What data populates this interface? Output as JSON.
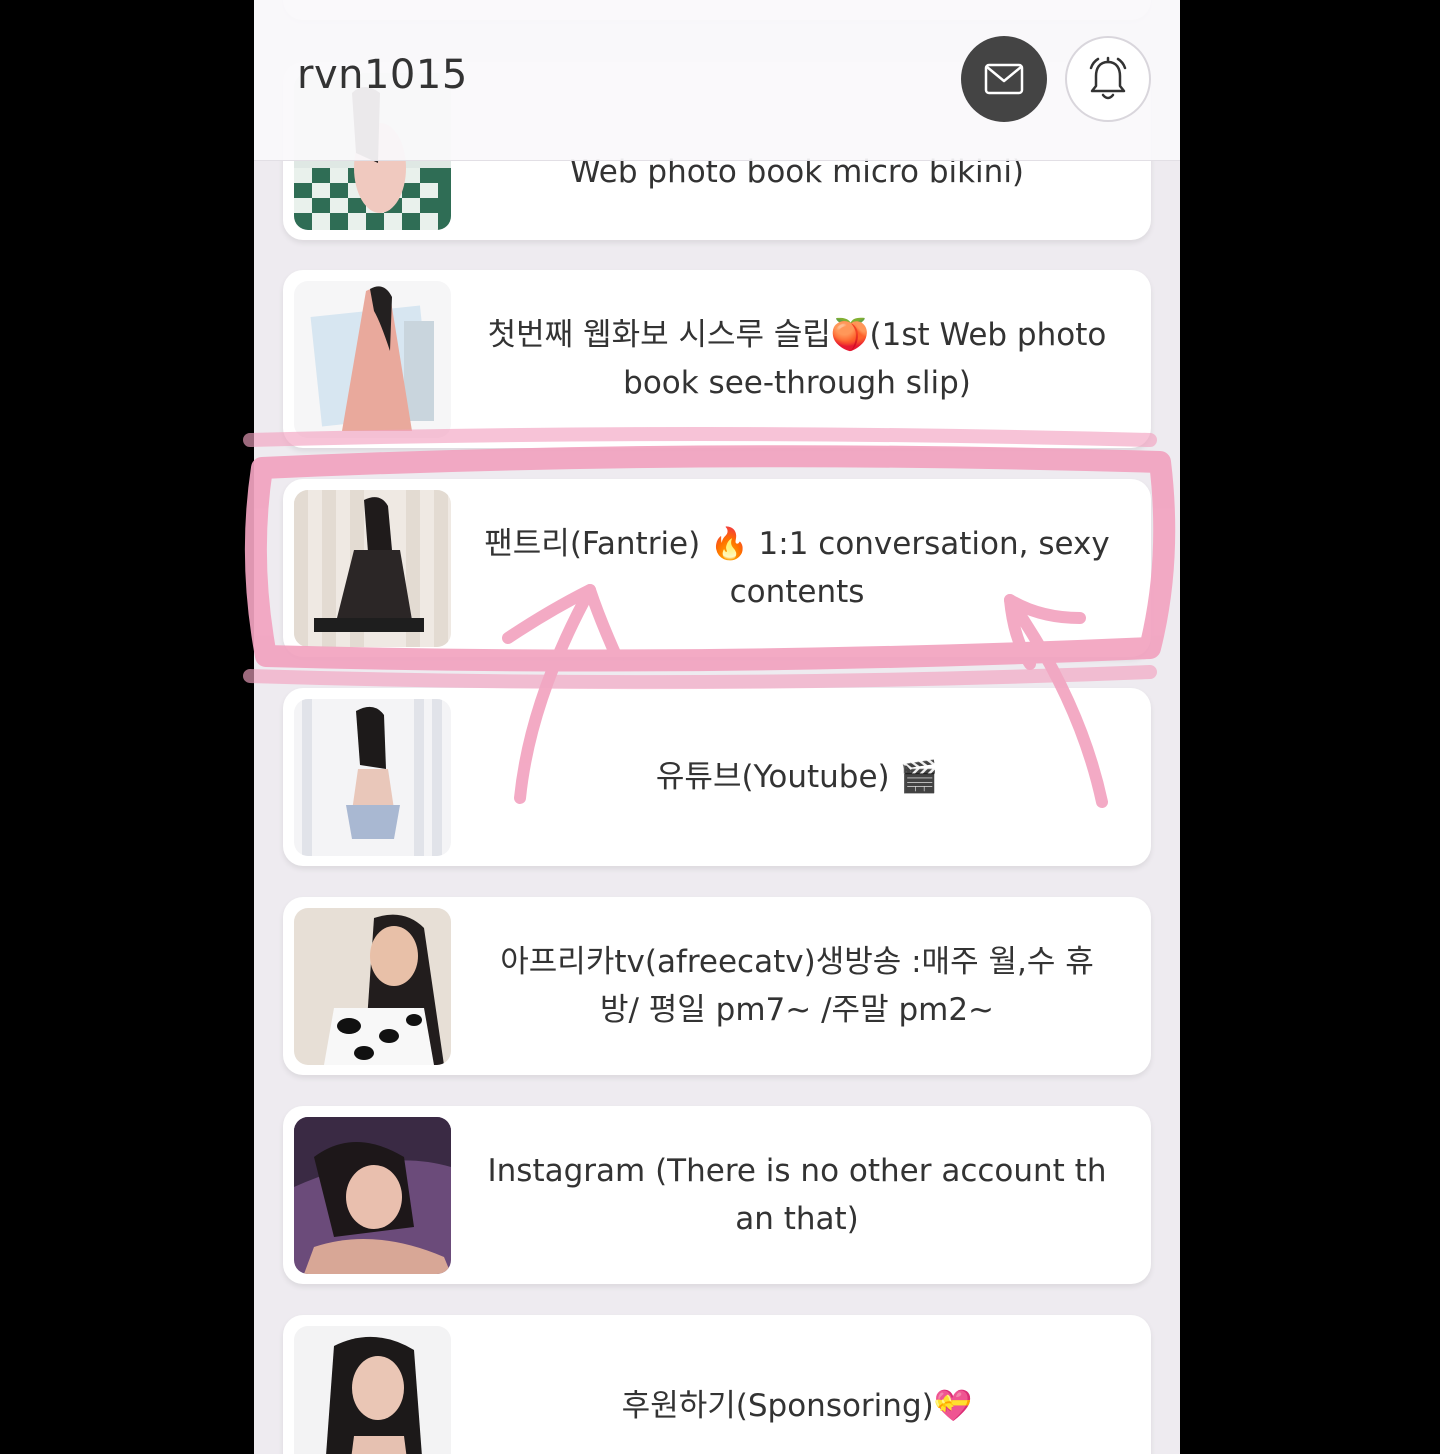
{
  "header": {
    "username": "rvn1015",
    "mail_icon": "mail-icon",
    "bell_icon": "bell-icon"
  },
  "links": [
    {
      "label": "Web photo book micro bikini)",
      "thumb_icon": "photo-thumbnail"
    },
    {
      "label": "첫번째 웹화보 시스루 슬립🍑(1st Web photo book see-through slip)",
      "thumb_icon": "photo-thumbnail"
    },
    {
      "label": "팬트리(Fantrie) 🔥 1:1 conversation, sexy contents",
      "thumb_icon": "photo-thumbnail"
    },
    {
      "label": "유튜브(Youtube) 🎬",
      "thumb_icon": "photo-thumbnail"
    },
    {
      "label": "아프리카tv(afreecatv)생방송 :매주 월,수 휴방/ 평일 pm7~ /주말 pm2~",
      "thumb_icon": "photo-thumbnail"
    },
    {
      "label": "Instagram (There is no other account than that)",
      "thumb_icon": "photo-thumbnail"
    },
    {
      "label": "후원하기(Sponsoring)💝",
      "thumb_icon": "photo-thumbnail"
    }
  ],
  "colors": {
    "page_bg": "#eeebf0",
    "card_bg": "#ffffff",
    "mail_button_bg": "#444444",
    "annotation_pink": "#f2a3c0",
    "text": "#333333"
  }
}
